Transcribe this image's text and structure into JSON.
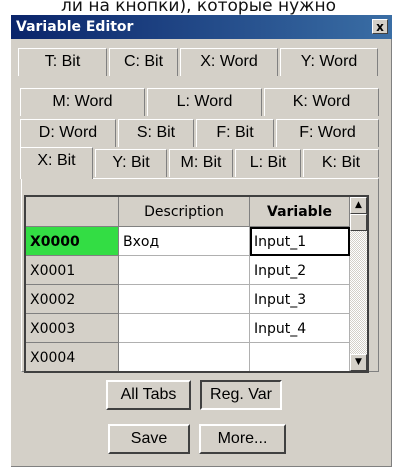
{
  "top_text": "ли на кнопки), которые нужно",
  "window": {
    "title": "Variable Editor",
    "close_label": "x"
  },
  "tabs": {
    "row1": [
      "T: Bit",
      "C: Bit",
      "X: Word",
      "Y: Word"
    ],
    "row2": [
      "M: Word",
      "L: Word",
      "K: Word"
    ],
    "row3": [
      "D: Word",
      "S: Bit",
      "F: Bit",
      "F: Word"
    ],
    "row4": [
      "X: Bit",
      "Y: Bit",
      "M: Bit",
      "L: Bit",
      "K: Bit"
    ],
    "active": "X: Bit"
  },
  "grid": {
    "headers": [
      "",
      "Description",
      "Variable"
    ],
    "rows": [
      {
        "address": "X0000",
        "description": "Вход",
        "variable": "Input_1"
      },
      {
        "address": "X0001",
        "description": "",
        "variable": "Input_2"
      },
      {
        "address": "X0002",
        "description": "",
        "variable": "Input_3"
      },
      {
        "address": "X0003",
        "description": "",
        "variable": "Input_4"
      },
      {
        "address": "X0004",
        "description": "",
        "variable": ""
      }
    ]
  },
  "buttons": {
    "all_tabs": "All Tabs",
    "reg_var": "Reg. Var",
    "save": "Save",
    "more": "More..."
  }
}
